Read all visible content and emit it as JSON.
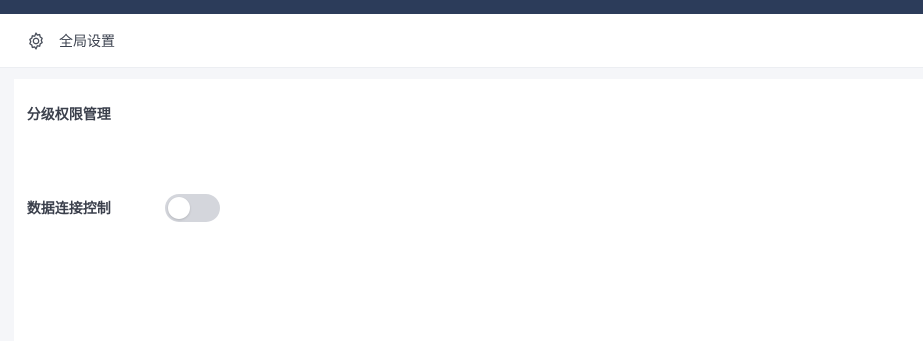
{
  "header": {
    "icon": "gear-icon",
    "title": "全局设置"
  },
  "section": {
    "title": "分级权限管理"
  },
  "settings": [
    {
      "label": "数据连接控制",
      "enabled": false
    }
  ],
  "colors": {
    "top_bar": "#2c3c5a",
    "toggle_off": "#d4d6dc"
  }
}
